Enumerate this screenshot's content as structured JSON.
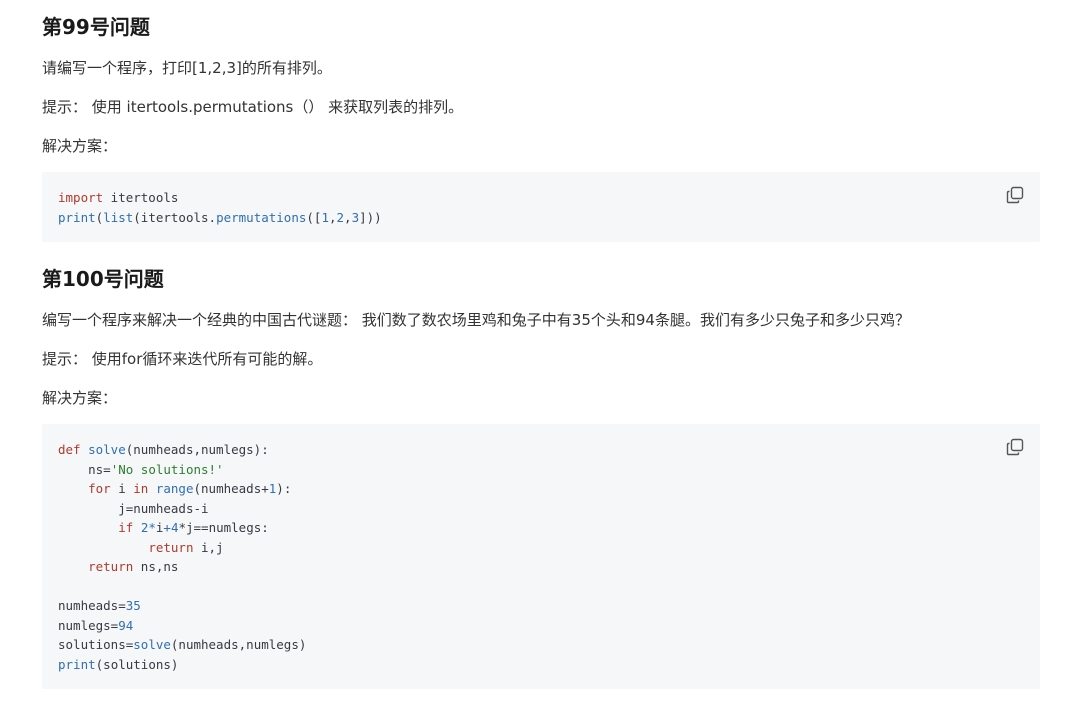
{
  "q99": {
    "title": "第99号问题",
    "question": "请编写一个程序，打印[1,2,3]的所有排列。",
    "hint": "提示： 使用 itertools.permutations（） 来获取列表的排列。",
    "solution_label": "解决方案：",
    "code": {
      "line1_kw": "import",
      "line1_rest": " itertools",
      "line2_print": "print",
      "line2_a": "(",
      "line2_list": "list",
      "line2_b": "(itertools.",
      "line2_perm": "permutations",
      "line2_c": "([",
      "n1": "1",
      "n2": "2",
      "n3": "3",
      "line2_end": "]))"
    }
  },
  "q100": {
    "title": "第100号问题",
    "question": "编写一个程序来解决一个经典的中国古代谜题： 我们数了数农场里鸡和兔子中有35个头和94条腿。我们有多少只兔子和多少只鸡？",
    "hint": "提示： 使用for循环来迭代所有可能的解。",
    "solution_label": "解决方案：",
    "code": {
      "def": "def",
      "solve": "solve",
      "sig": "(numheads,numlegs):",
      "ns_assign": "ns=",
      "ns_str": "'No solutions!'",
      "for": "for",
      "i": " i ",
      "in": "in",
      "range": "range",
      "range_arg": "(numheads+",
      "one": "1",
      "range_end": "):",
      "j_line": "j=numheads-i",
      "if": "if",
      "two": "2",
      "four": "4",
      "cond_rest": "*j==numlegs:",
      "return": "return",
      "ret_ij": " i,j",
      "ret_ns": " ns,ns",
      "numheads_assign": "numheads=",
      "v35": "35",
      "numlegs_assign": "numlegs=",
      "v94": "94",
      "sol_assign": "solutions=",
      "sol_call": "solve",
      "sol_args": "(numheads,numlegs)",
      "print": "print",
      "print_args": "(solutions)"
    }
  },
  "icons": {
    "copy": "copy-icon"
  }
}
